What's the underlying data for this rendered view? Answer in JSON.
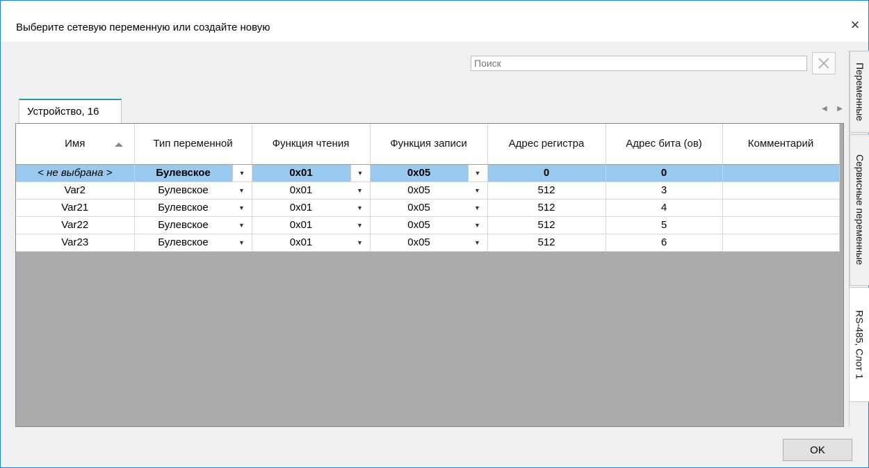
{
  "window": {
    "title": "Выберите сетевую переменную или создайте новую",
    "close_glyph": "×"
  },
  "search": {
    "placeholder": "Поиск",
    "clear_icon": "clear-x-icon"
  },
  "device_tab": {
    "label": "Устройство, 16"
  },
  "tab_nav": {
    "left": "◀",
    "right": "▶"
  },
  "grid": {
    "columns": [
      "Имя",
      "Тип переменной",
      "Функция чтения",
      "Функция записи",
      "Адрес регистра",
      "Адрес бита (ов)",
      "Комментарий"
    ],
    "sorted_column": "Имя",
    "rows": [
      {
        "name": "< не выбрана >",
        "type": "Булевское",
        "read": "0x01",
        "write": "0x05",
        "reg": "0",
        "bit": "0",
        "comment": "",
        "selected": true
      },
      {
        "name": "Var2",
        "type": "Булевское",
        "read": "0x01",
        "write": "0x05",
        "reg": "512",
        "bit": "3",
        "comment": ""
      },
      {
        "name": "Var21",
        "type": "Булевское",
        "read": "0x01",
        "write": "0x05",
        "reg": "512",
        "bit": "4",
        "comment": ""
      },
      {
        "name": "Var22",
        "type": "Булевское",
        "read": "0x01",
        "write": "0x05",
        "reg": "512",
        "bit": "5",
        "comment": ""
      },
      {
        "name": "Var23",
        "type": "Булевское",
        "read": "0x01",
        "write": "0x05",
        "reg": "512",
        "bit": "6",
        "comment": ""
      }
    ],
    "selection_color": "#99c9ef"
  },
  "side_tabs": [
    {
      "label": "Переменные",
      "active": false
    },
    {
      "label": "Сервисные переменные",
      "active": false
    },
    {
      "label": "RS-485, Слот 1",
      "active": true
    }
  ],
  "ok_button": {
    "label": "OK"
  }
}
